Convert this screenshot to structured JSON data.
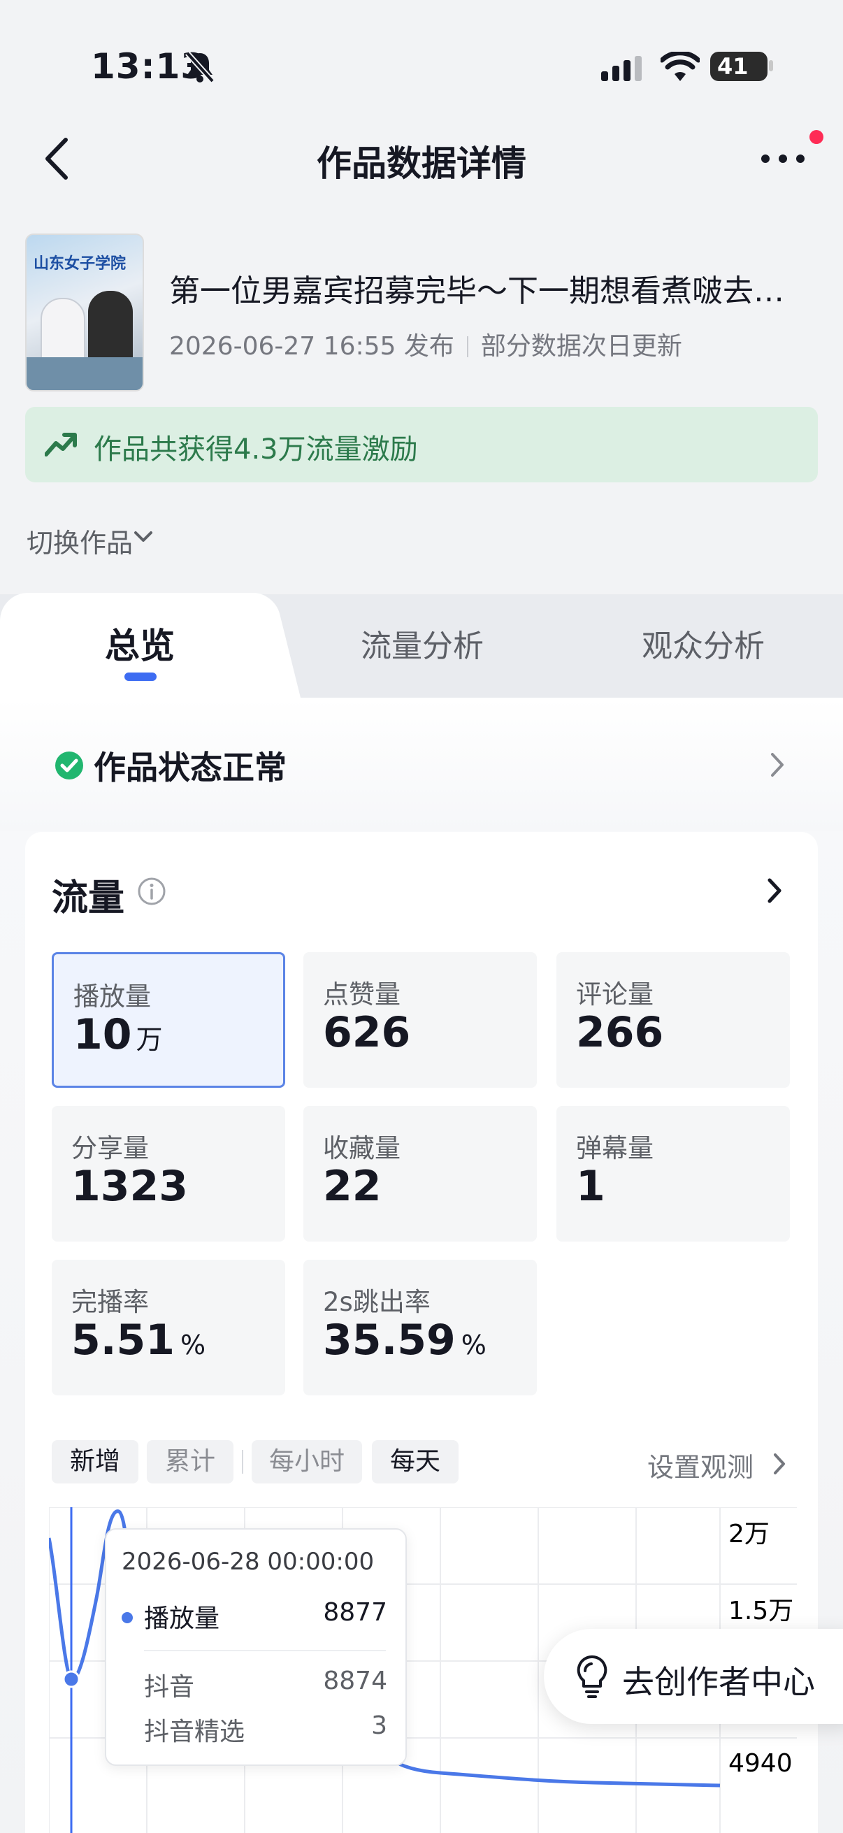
{
  "status_bar": {
    "time": "13:13",
    "battery": "41"
  },
  "nav": {
    "title": "作品数据详情"
  },
  "post": {
    "title": "第一位男嘉宾招募完毕～下一期想看煮啵去…",
    "thumb_title": "山东女子学院",
    "published": "2026-06-27 16:55 发布",
    "update_note": "部分数据次日更新"
  },
  "banner": {
    "text": "作品共获得4.3万流量激励"
  },
  "switch_work": "切换作品",
  "tabs": [
    {
      "label": "总览",
      "active": true
    },
    {
      "label": "流量分析",
      "active": false
    },
    {
      "label": "观众分析",
      "active": false
    }
  ],
  "work_status": "作品状态正常",
  "traffic": {
    "title": "流量",
    "metrics": [
      {
        "label": "播放量",
        "value": "10",
        "unit": "万",
        "selected": true
      },
      {
        "label": "点赞量",
        "value": "626"
      },
      {
        "label": "评论量",
        "value": "266"
      },
      {
        "label": "分享量",
        "value": "1323"
      },
      {
        "label": "收藏量",
        "value": "22"
      },
      {
        "label": "弹幕量",
        "value": "1"
      },
      {
        "label": "完播率",
        "value": "5.51",
        "unit": "%"
      },
      {
        "label": "2s跳出率",
        "value": "35.59",
        "unit": "%"
      }
    ],
    "controls": {
      "new": "新增",
      "cumulative": "累计",
      "hourly": "每小时",
      "daily": "每天",
      "observe": "设置观测"
    },
    "y_ticks": [
      "2万",
      "1.5万",
      "4940"
    ],
    "tooltip": {
      "date": "2026-06-28 00:00:00",
      "main_label": "播放量",
      "main_value": "8877",
      "rows": [
        {
          "label": "抖音",
          "value": "8874"
        },
        {
          "label": "抖音精选",
          "value": "3"
        }
      ]
    }
  },
  "fab": {
    "label": "去创作者中心"
  },
  "colors": {
    "accent": "#3d6cf2",
    "line": "#4a78e8",
    "banner_bg": "#dcefe3",
    "banner_text": "#2c7a4b",
    "red_dot": "#fe2c55"
  }
}
